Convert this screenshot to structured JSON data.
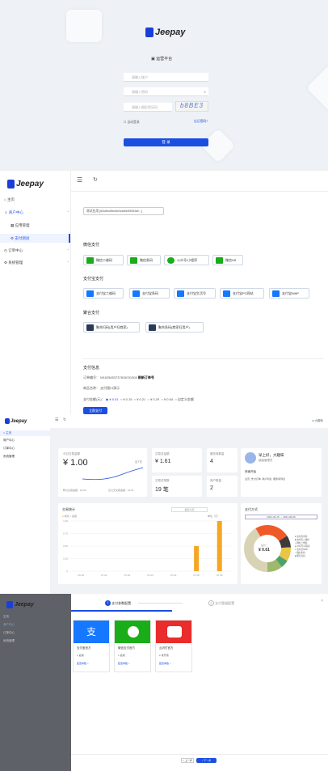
{
  "login": {
    "brand": "Jeepay",
    "platform": "运营平台",
    "username_ph": "请输入账户",
    "password_ph": "请输入密码",
    "captcha_ph": "请输入图形验证码",
    "captcha_text": "b8BE3",
    "remember": "自动登录",
    "forgot": "忘记密码?",
    "submit": "登 录"
  },
  "nav": {
    "brand": "Jeepay",
    "home": "主页",
    "merchant": "商户中心",
    "app_mgmt": "应用管理",
    "pay_test": "支付测试",
    "order": "订单中心",
    "system": "系统管理"
  },
  "paytest": {
    "app_select": "测试应用 [60c8bd5ed4e3da6e59063df...]",
    "wx_title": "微信支付",
    "wx": [
      "微信二维码",
      "微信条码",
      "公众号/小程序",
      "微信H5"
    ],
    "ali_title": "支付宝支付",
    "ali": [
      "支付宝二维码",
      "支付宝条码",
      "支付宝生活号",
      "支付宝PC网站",
      "支付宝WAP"
    ],
    "agg_title": "聚合支付",
    "agg": [
      "聚合扫码(用户扫商家)",
      "聚合条码(商家扫用户)"
    ],
    "info_title": "支付信息",
    "order_label": "订单编号：",
    "order_no": "M1625653737815031308",
    "refresh": "刷新订单号",
    "goods_label": "商品名称：",
    "goods": "支付接口演示",
    "amount_label": "支付金额(元)：",
    "amounts": [
      "¥ 0.01",
      "¥ 0.15",
      "¥ 0.21",
      "¥ 0.29",
      "¥ 0.64",
      "自定义金额"
    ],
    "pay_btn": "立即支付"
  },
  "dash": {
    "user": "大趣味",
    "today_label": "今日交易金额",
    "today": "¥ 1.00",
    "days": "近7天",
    "yest_label": "昨日交易金额：¥0.00",
    "month_label": "近七天交易金额：¥1.61",
    "total_amount_label": "交易总金额",
    "total_amount": "¥ 1.61",
    "agent_label": "服务商数量",
    "agent": "4",
    "total_count_label": "交易总笔数",
    "total_count": "19 笔",
    "merchant_label": "商户数量",
    "merchant": "2",
    "greet": "早上好，大趣味",
    "role": "超级管理员",
    "quick": "快速开始",
    "links": [
      "主页",
      "支付订单",
      "商户列表",
      "服务商列表"
    ],
    "chart_title": "交易统计",
    "last7": "最近七天",
    "legend": [
      "成功",
      "失败"
    ],
    "unit": "单位（元）",
    "yticks": [
      "1.00",
      "0.75",
      "0.50",
      "0.25",
      "0"
    ],
    "xticks": [
      "06-30",
      "07-01",
      "07-02",
      "07-03",
      "07-04",
      "07-05",
      "07-06"
    ],
    "pie_title": "支付方式",
    "date_from": "2021-03-15",
    "date_to": "2021-06-06",
    "total": "总计",
    "pie_total": "¥ 0.61",
    "pie_legend": [
      "支付宝条码",
      "支付宝二维码",
      "微信二维码",
      "公众号/小程序",
      "支付宝WAP",
      "微信条码",
      "聚合扫码"
    ]
  },
  "wizard": {
    "step1": "支付参数配置",
    "step2": "支付渠道配置",
    "cards": [
      {
        "name": "支付宝官方",
        "status": "启用",
        "link": "配置参数 >"
      },
      {
        "name": "微信支付官方",
        "status": "启用",
        "link": "配置参数 >"
      },
      {
        "name": "云闪付官方",
        "status": "未开通",
        "link": "配置参数 >"
      }
    ],
    "prev": "< 上一步",
    "next": "> 下一步"
  },
  "chart_data": {
    "type": "bar",
    "categories": [
      "06-30",
      "07-01",
      "07-02",
      "07-03",
      "07-04",
      "07-05",
      "07-06"
    ],
    "series": [
      {
        "name": "成功",
        "values": [
          0,
          0,
          0,
          0,
          0,
          0.5,
          1.0
        ]
      },
      {
        "name": "失败",
        "values": [
          0,
          0,
          0,
          0,
          0,
          0,
          0
        ]
      }
    ],
    "ylabel": "单位（元）",
    "ylim": [
      0,
      1
    ],
    "legend": "top-left"
  },
  "colors": {
    "primary": "#1c4fe0",
    "wx": "#1aad19",
    "ali": "#1677ff",
    "qr": "#2b3a55",
    "orange": "#f5a623"
  }
}
